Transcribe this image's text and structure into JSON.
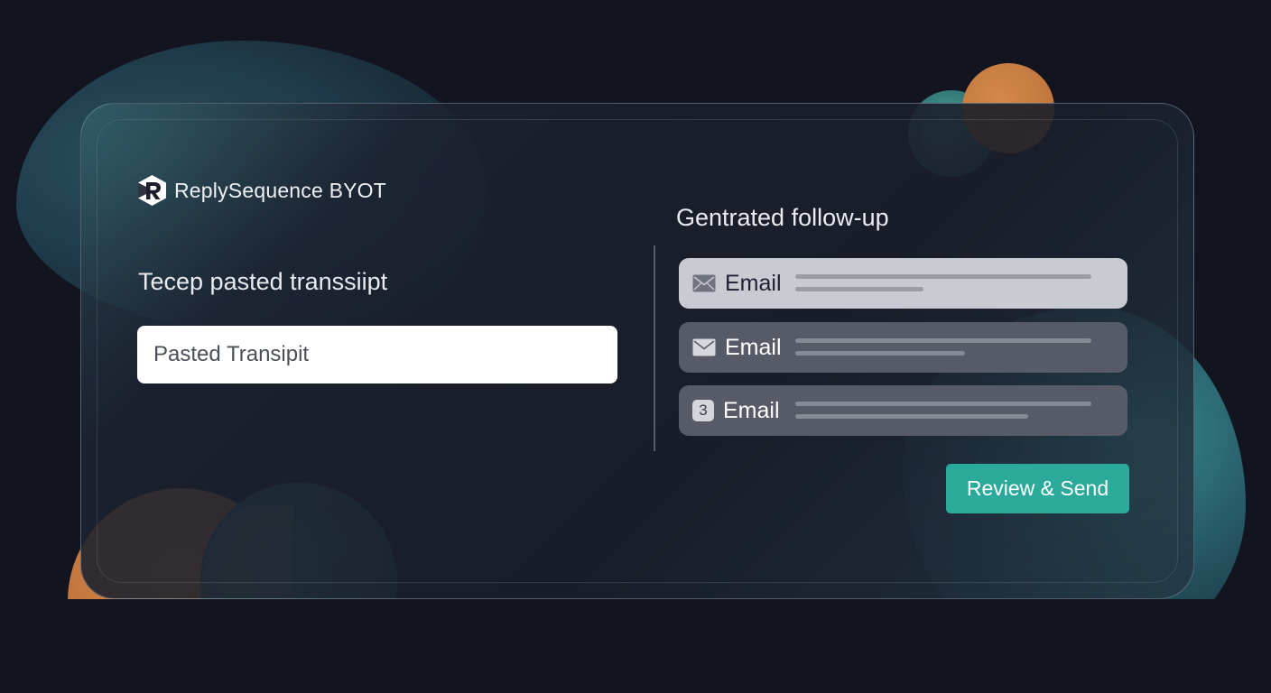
{
  "app": {
    "brand_name": "ReplySequence BYOT"
  },
  "input_panel": {
    "heading": "Tecep pasted transsiipt",
    "transcript_placeholder": "Pasted Transipit"
  },
  "output_panel": {
    "heading": "Gentrated follow-up",
    "emails": [
      {
        "icon": "mail-icon",
        "label": "Email"
      },
      {
        "icon": "mail-icon",
        "label": "Email"
      },
      {
        "icon": "number-badge",
        "badge": "3",
        "label": "Email"
      }
    ]
  },
  "actions": {
    "send_label": "Review & Send"
  },
  "colors": {
    "accent": "#2ba99b",
    "background": "#121520",
    "orange": "#d4884a",
    "teal": "#3c8a88"
  }
}
